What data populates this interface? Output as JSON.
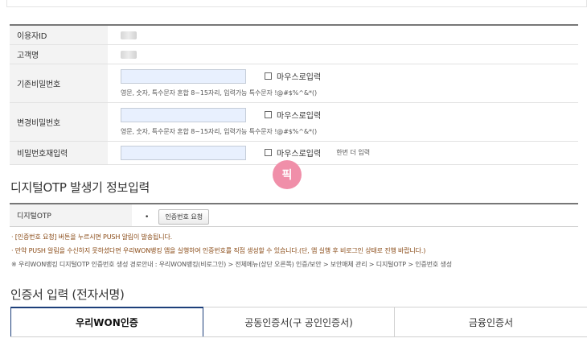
{
  "form": {
    "rows": [
      {
        "label": "이용자ID"
      },
      {
        "label": "고객명"
      },
      {
        "label": "기존비밀번호",
        "mouse_label": "마우스로입력",
        "hint": "영문, 숫자, 특수문자 혼합 8~15자리, 입력가능 특수문자 !@#$%^&*()"
      },
      {
        "label": "변경비밀번호",
        "mouse_label": "마우스로입력",
        "hint": "영문, 숫자, 특수문자 혼합 8~15자리, 입력가능 특수문자 !@#$%^&*()"
      },
      {
        "label": "비밀번호재입력",
        "mouse_label": "마우스로입력",
        "extra": "한번 더 입력"
      }
    ]
  },
  "otp_section": {
    "title": "디지털OTP 발생기 정보입력",
    "label": "디지털OTP",
    "bullet": "•",
    "button": "인증번호 요청"
  },
  "notes": [
    "· [인증번호 요청] 버튼을 누르시면 PUSH 알림이 발송됩니다.",
    "· 만약 PUSH 알림을 수신하지 못하셨다면 우리WON뱅킹 앱을 실행하여 인증번호를 직접 생성할 수 있습니다.(단, 앱 실행 후 비로그인 상태로 진행 바랍니다.)",
    "※ 우리WON뱅킹 디지털OTP 인증번호 생성 경로안내 : 우리WON뱅킹(비로그인) > 전체메뉴(상단 오른쪽) 인증/보안 > 보안매체 관리 > 디지털OTP > 인증번호 생성"
  ],
  "badge": "픽",
  "cert_section": {
    "title": "인증서 입력 (전자서명)",
    "tabs": [
      "우리WON인증",
      "공동인증서(구 공인인증서)",
      "금융인증서"
    ]
  }
}
